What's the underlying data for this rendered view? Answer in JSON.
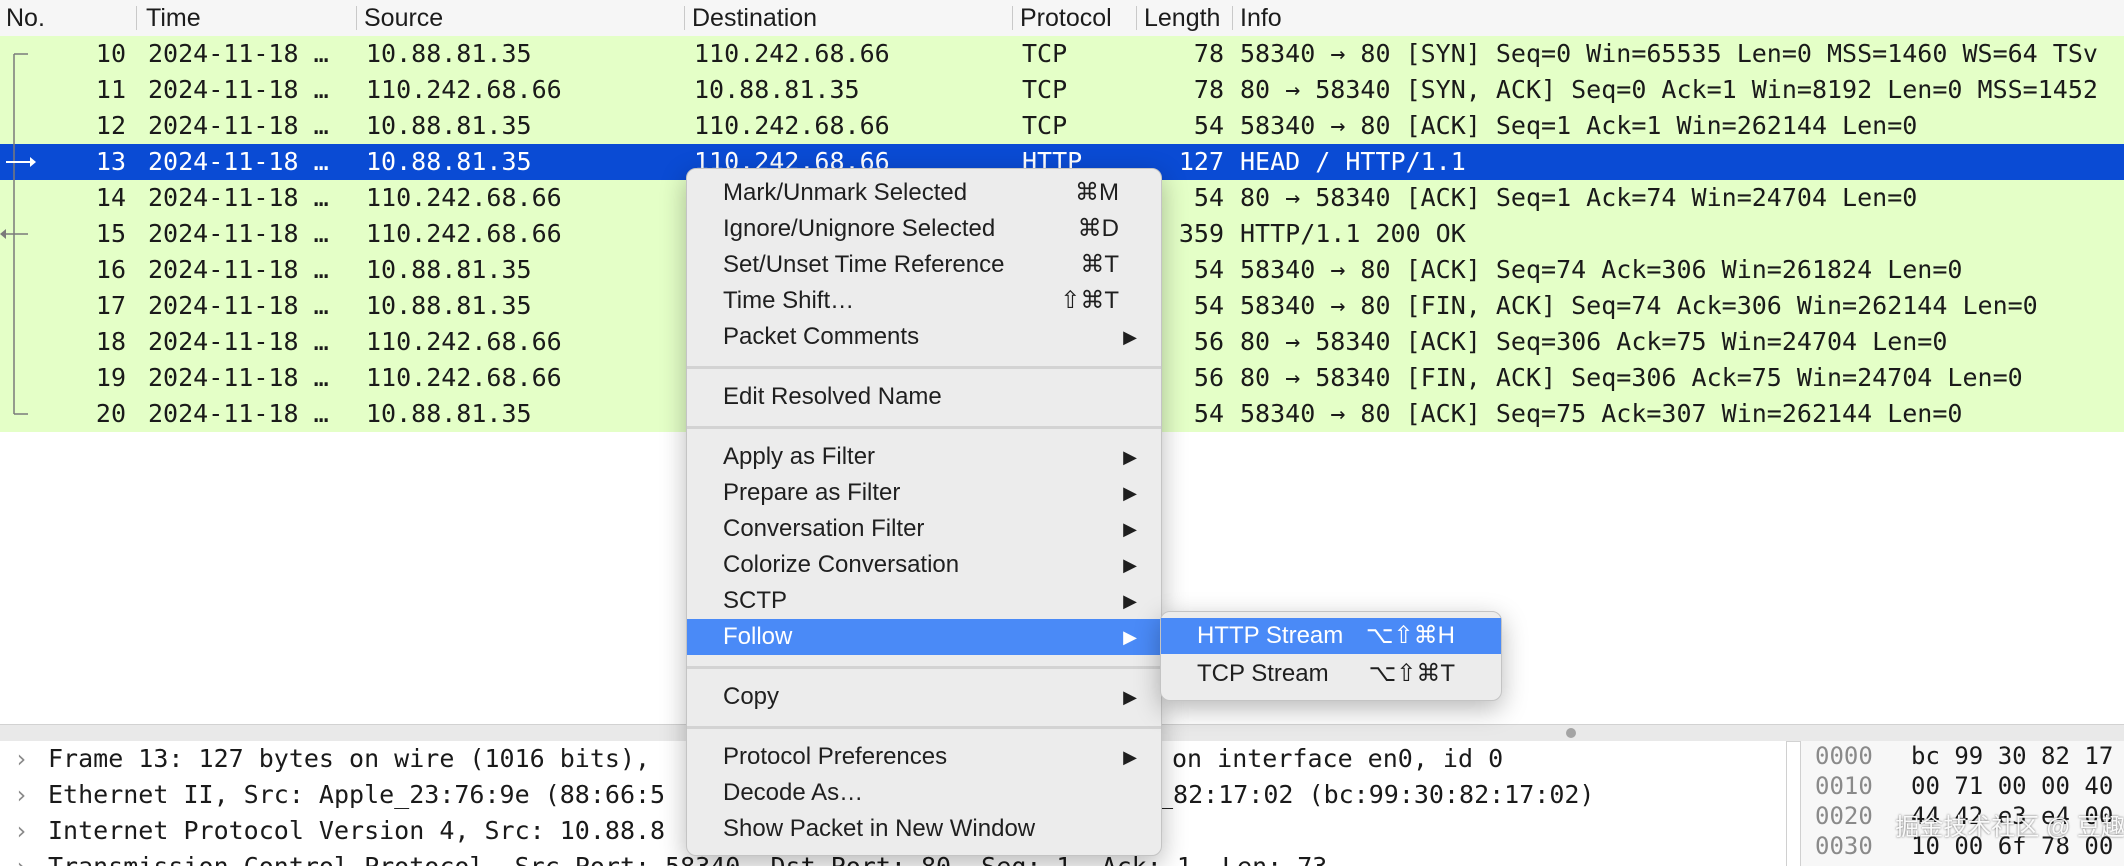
{
  "columns": {
    "no": "No.",
    "time": "Time",
    "source": "Source",
    "destination": "Destination",
    "protocol": "Protocol",
    "length": "Length",
    "info": "Info"
  },
  "packets": [
    {
      "no": "10",
      "time": "2024-11-18 …",
      "src": "10.88.81.35",
      "dst": "110.242.68.66",
      "proto": "TCP",
      "len": "78",
      "info": "58340 → 80 [SYN] Seq=0 Win=65535 Len=0 MSS=1460 WS=64 TSv"
    },
    {
      "no": "11",
      "time": "2024-11-18 …",
      "src": "110.242.68.66",
      "dst": "10.88.81.35",
      "proto": "TCP",
      "len": "78",
      "info": "80 → 58340 [SYN, ACK] Seq=0 Ack=1 Win=8192 Len=0 MSS=1452"
    },
    {
      "no": "12",
      "time": "2024-11-18 …",
      "src": "10.88.81.35",
      "dst": "110.242.68.66",
      "proto": "TCP",
      "len": "54",
      "info": "58340 → 80 [ACK] Seq=1 Ack=1 Win=262144 Len=0"
    },
    {
      "no": "13",
      "time": "2024-11-18 …",
      "src": "10.88.81.35",
      "dst": "110.242.68.66",
      "proto": "HTTP",
      "len": "127",
      "info": "HEAD / HTTP/1.1"
    },
    {
      "no": "14",
      "time": "2024-11-18 …",
      "src": "110.242.68.66",
      "dst": "",
      "proto": "",
      "len": "54",
      "info": "80 → 58340 [ACK] Seq=1 Ack=74 Win=24704 Len=0"
    },
    {
      "no": "15",
      "time": "2024-11-18 …",
      "src": "110.242.68.66",
      "dst": "",
      "proto": "",
      "len": "359",
      "info": "HTTP/1.1 200 OK"
    },
    {
      "no": "16",
      "time": "2024-11-18 …",
      "src": "10.88.81.35",
      "dst": "",
      "proto": "",
      "len": "54",
      "info": "58340 → 80 [ACK] Seq=74 Ack=306 Win=261824 Len=0"
    },
    {
      "no": "17",
      "time": "2024-11-18 …",
      "src": "10.88.81.35",
      "dst": "",
      "proto": "",
      "len": "54",
      "info": "58340 → 80 [FIN, ACK] Seq=74 Ack=306 Win=262144 Len=0"
    },
    {
      "no": "18",
      "time": "2024-11-18 …",
      "src": "110.242.68.66",
      "dst": "",
      "proto": "",
      "len": "56",
      "info": "80 → 58340 [ACK] Seq=306 Ack=75 Win=24704 Len=0"
    },
    {
      "no": "19",
      "time": "2024-11-18 …",
      "src": "110.242.68.66",
      "dst": "",
      "proto": "",
      "len": "56",
      "info": "80 → 58340 [FIN, ACK] Seq=306 Ack=75 Win=24704 Len=0"
    },
    {
      "no": "20",
      "time": "2024-11-18 …",
      "src": "10.88.81.35",
      "dst": "",
      "proto": "",
      "len": "54",
      "info": "58340 → 80 [ACK] Seq=75 Ack=307 Win=262144 Len=0"
    }
  ],
  "selected_packet": "13",
  "context_menu": {
    "items": [
      {
        "label": "Mark/Unmark Selected",
        "shortcut": "⌘M",
        "submenu": false
      },
      {
        "label": "Ignore/Unignore Selected",
        "shortcut": "⌘D",
        "submenu": false
      },
      {
        "label": "Set/Unset Time Reference",
        "shortcut": "⌘T",
        "submenu": false
      },
      {
        "label": "Time Shift…",
        "shortcut": "⇧⌘T",
        "submenu": false
      },
      {
        "label": "Packet Comments",
        "shortcut": "",
        "submenu": true
      },
      {
        "label": "Edit Resolved Name",
        "shortcut": "",
        "submenu": false
      },
      {
        "label": "Apply as Filter",
        "shortcut": "",
        "submenu": true
      },
      {
        "label": "Prepare as Filter",
        "shortcut": "",
        "submenu": true
      },
      {
        "label": "Conversation Filter",
        "shortcut": "",
        "submenu": true
      },
      {
        "label": "Colorize Conversation",
        "shortcut": "",
        "submenu": true
      },
      {
        "label": "SCTP",
        "shortcut": "",
        "submenu": true
      },
      {
        "label": "Follow",
        "shortcut": "",
        "submenu": true,
        "active": true
      },
      {
        "label": "Copy",
        "shortcut": "",
        "submenu": true
      },
      {
        "label": "Protocol Preferences",
        "shortcut": "",
        "submenu": true
      },
      {
        "label": "Decode As…",
        "shortcut": "",
        "submenu": false
      },
      {
        "label": "Show Packet in New Window",
        "shortcut": "",
        "submenu": false
      }
    ],
    "submenu_arrow": "▶"
  },
  "follow_submenu": {
    "items": [
      {
        "label": "HTTP Stream",
        "shortcut": "⌥⇧⌘H",
        "active": true
      },
      {
        "label": "TCP Stream",
        "shortcut": "⌥⇧⌘T",
        "active": false
      }
    ]
  },
  "details": {
    "rows": [
      {
        "left": "Frame 13: 127 bytes on wire (1016 bits),",
        "right": "on interface en0, id 0"
      },
      {
        "left": "Ethernet II, Src: Apple_23:76:9e (88:66:5",
        "right": "_82:17:02 (bc:99:30:82:17:02)"
      },
      {
        "left": "Internet Protocol Version 4, Src: 10.88.8",
        "right": ""
      },
      {
        "left": "Transmission Control Protocol, Src Port: 58340, Dst Port: 80, Seq: 1, Ack: 1, Len: 73",
        "right": ""
      }
    ],
    "expander": "›"
  },
  "bytes": {
    "rows": [
      {
        "offset": "0000",
        "hex": "bc 99 30 82 17"
      },
      {
        "offset": "0010",
        "hex": "00 71 00 00 40"
      },
      {
        "offset": "0020",
        "hex": "44 42 e3 e4 00"
      },
      {
        "offset": "0030",
        "hex": "10 00 6f 78 00"
      }
    ]
  },
  "watermark": "掘金技术社区 @ 豆趣",
  "colors": {
    "row_bg": "#e4ffc7",
    "selected_bg": "#0a4bd4",
    "menu_highlight": "#4a8af7"
  }
}
